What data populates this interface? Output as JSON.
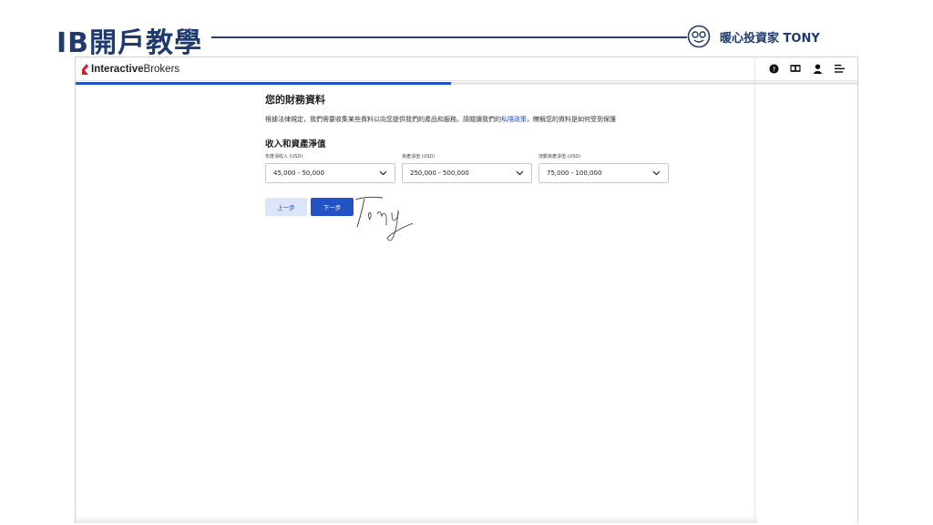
{
  "slide": {
    "title": "IB開戶教學",
    "brand_text": "暖心投資家 TONY"
  },
  "app": {
    "logo_bold": "Interactive",
    "logo_rest": "Brokers",
    "icons": [
      "help-icon",
      "language-icon",
      "user-icon",
      "menu-icon"
    ],
    "progress": 0.48,
    "accent_color": "#2352c4"
  },
  "page": {
    "heading": "您的財務資料",
    "description_before": "根據法律規定，我們需要收集某些資料以向您提供我們的產品和服務。請閱讀我們的",
    "privacy_link": "私隱政策",
    "description_after": "，瞭解您的資料是如何受到保護",
    "section_heading": "收入和資產淨值"
  },
  "fields": [
    {
      "label": "年度淨收入 (USD)",
      "value": "45,000 - 50,000"
    },
    {
      "label": "資產淨值 (USD)",
      "value": "250,000 - 500,000"
    },
    {
      "label": "流動資產淨值 (USD)",
      "value": "75,000 - 100,000"
    }
  ],
  "buttons": {
    "back": "上一步",
    "next": "下一步"
  }
}
